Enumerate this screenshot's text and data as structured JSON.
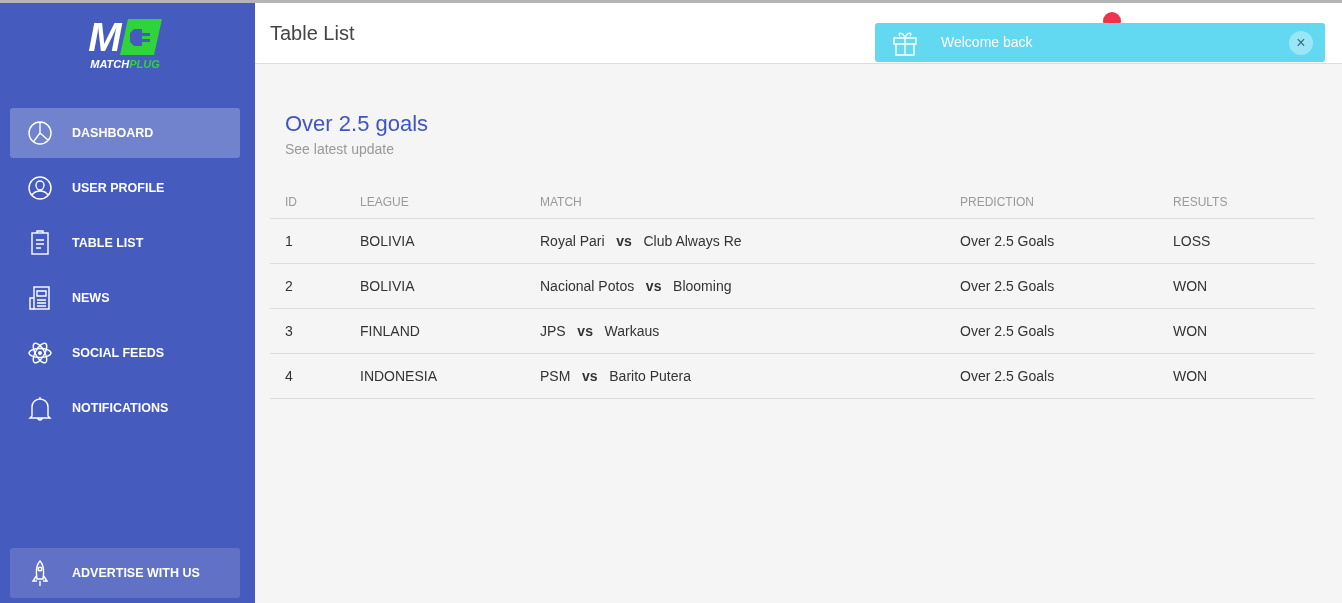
{
  "logo": {
    "mark": "M",
    "word_1": "MATCH",
    "word_2": "PLUG"
  },
  "sidebar": {
    "items": [
      {
        "label": "DASHBOARD",
        "selected": true
      },
      {
        "label": "USER PROFILE",
        "selected": false
      },
      {
        "label": "TABLE LIST",
        "selected": false
      },
      {
        "label": "NEWS",
        "selected": false
      },
      {
        "label": "SOCIAL FEEDS",
        "selected": false
      },
      {
        "label": "NOTIFICATIONS",
        "selected": false
      }
    ],
    "bottom_button": "ADVERTISE WITH US"
  },
  "header": {
    "title": "Table List"
  },
  "toast": {
    "message": "Welcome back",
    "close": "×"
  },
  "card": {
    "title": "Over 2.5 goals",
    "subtitle": "See latest update"
  },
  "table": {
    "columns": [
      "ID",
      "LEAGUE",
      "MATCH",
      "PREDICTION",
      "RESULTS"
    ],
    "rows": [
      [
        "1",
        "BOLIVIA",
        "Royal Pari   **vs**   Club Always Re",
        "Over 2.5 Goals",
        "LOSS"
      ],
      [
        "2",
        "BOLIVIA",
        "Nacional Potos   **vs**   Blooming",
        "Over 2.5 Goals",
        "WON"
      ],
      [
        "3",
        "FINLAND",
        "JPS   **vs**   Warkaus",
        "Over 2.5 Goals",
        "WON"
      ],
      [
        "4",
        "INDONESIA",
        "PSM   **vs**   Barito Putera",
        "Over 2.5 Goals",
        "WON"
      ]
    ]
  }
}
